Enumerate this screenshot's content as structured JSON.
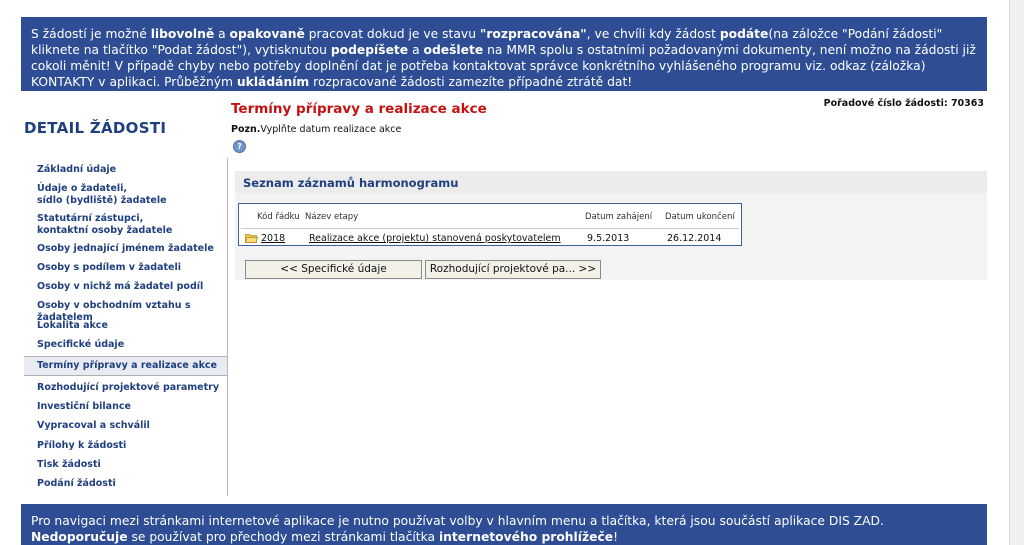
{
  "banner": {
    "p1": "S žádostí je možné ",
    "b1": "libovolně",
    "p2": " a ",
    "b2": "opakovaně",
    "p3": " pracovat dokud je ve stavu ",
    "b3": "\"rozpracována\"",
    "p4": ", ve chvíli kdy žádost ",
    "b4": "podáte",
    "p5": "(na záložce \"Podání žádosti\" kliknete na tlačítko \"Podat žádost\"), vytisknutou ",
    "b5": "podepíšete",
    "p6": " a ",
    "b6": "odešlete",
    "p7": " na MMR spolu s ostatními požadovanými dokumenty, není možno na žádosti již cokoli měnit! V případě chyby nebo potřeby doplnění dat je potřeba kontaktovat správce konkrétního vyhlášeného programu viz. odkaz (záložka) KONTAKTY v aplikaci. Průběžným ",
    "b7": "ukládáním",
    "p8": " rozpracované žádosti zamezíte případné ztrátě dat!"
  },
  "sidebar": {
    "title": "DETAIL ŽÁDOSTI",
    "items": [
      {
        "label": "Základní údaje"
      },
      {
        "label": "Údaje o žadateli,"
      },
      {
        "label": "sídlo (bydliště) žadatele"
      },
      {
        "label": "Statutární zástupci,"
      },
      {
        "label": "kontaktní osoby žadatele"
      },
      {
        "label": "Osoby jednající jménem žadatele"
      },
      {
        "label": "Osoby s podílem v žadateli"
      },
      {
        "label": "Osoby v nichž má žadatel podíl"
      },
      {
        "label": "Osoby v obchodním vztahu s žadatelem"
      },
      {
        "label": "Lokalita akce"
      },
      {
        "label": "Specifické údaje"
      },
      {
        "label": "Termíny přípravy a realizace akce"
      },
      {
        "label": "Rozhodující projektové parametry"
      },
      {
        "label": "Investiční bilance"
      },
      {
        "label": "Vypracoval a schválil"
      },
      {
        "label": "Přílohy k žádosti"
      },
      {
        "label": "Tisk žádosti"
      },
      {
        "label": "Podání žádosti"
      }
    ]
  },
  "main": {
    "title": "Termíny přípravy a realizace akce",
    "order_label": "Pořadové číslo žádosti: 70363",
    "note_bold": "Pozn.",
    "note_text": "Vyplňte datum realizace akce",
    "help_glyph": "?",
    "section_title": "Seznam záznamů harmonogramu",
    "table": {
      "headers": [
        "Kód řádku",
        "Název etapy",
        "Datum zahájení",
        "Datum ukončení"
      ],
      "rows": [
        {
          "code": "2018",
          "name": "Realizace akce (projektu) stanovená poskytovatelem",
          "start": "9.5.2013",
          "end": "26.12.2014"
        }
      ]
    },
    "buttons": {
      "prev": "<<  Specifické údaje",
      "next": "Rozhodující projektové pa...  >>"
    }
  },
  "footer": {
    "p1": "Pro navigaci mezi stránkami internetové aplikace je nutno používat volby v hlavním menu a tlačítka, která jsou součástí aplikace DIS ZAD. ",
    "b1": "Nedoporučuje",
    "p2": " se používat pro přechody mezi stránkami tlačítka ",
    "b2": "internetového prohlížeče",
    "p3": "!"
  },
  "colors": {
    "banner_bg": "#2e4d94",
    "title_red": "#c41212",
    "nav_blue": "#1f3f7f"
  }
}
